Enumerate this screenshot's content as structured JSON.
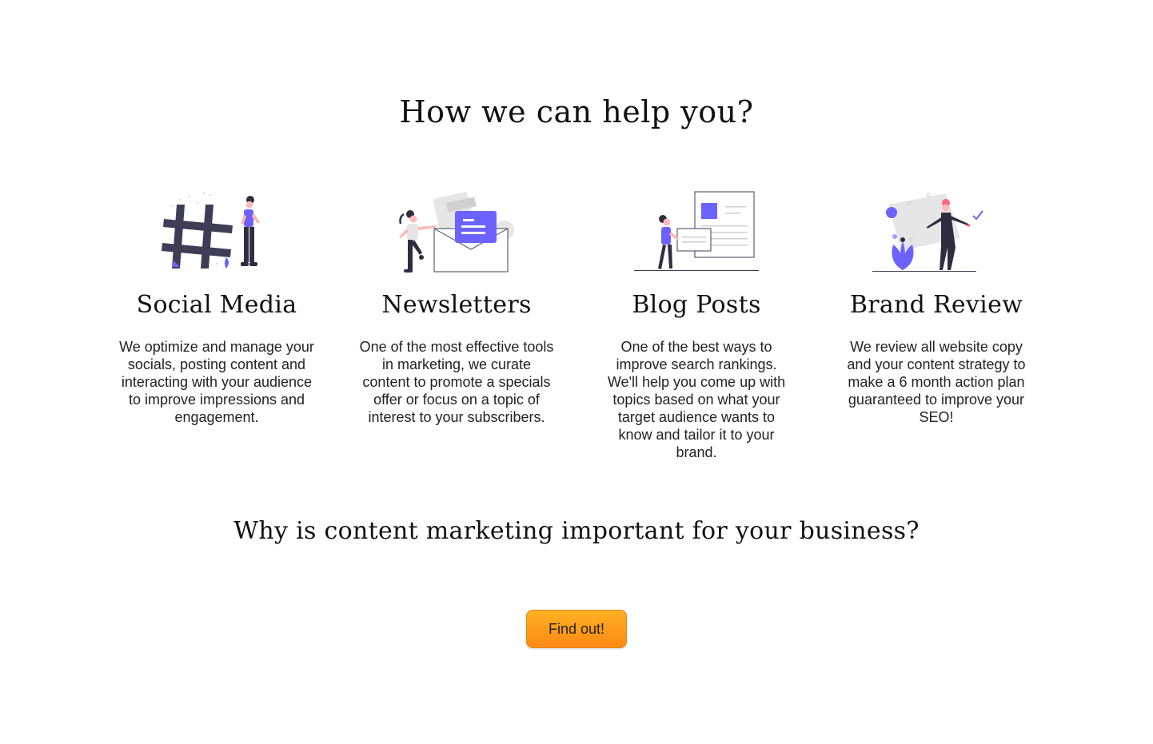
{
  "heading": "How we can help you?",
  "services": [
    {
      "title": "Social Media",
      "description": "We optimize and manage your socials, posting content and interacting with your audience to improve impressions and engagement.",
      "icon": "hashtag-illustration"
    },
    {
      "title": "Newsletters",
      "description": "One of the most effective tools in marketing, we curate content to promote a specials offer or focus on a topic of interest to your subscribers.",
      "icon": "envelope-illustration"
    },
    {
      "title": "Blog Posts",
      "description": "One of the best ways to improve search rankings. We'll help you come up with topics based on what your target audience wants to know and tailor it to your brand.",
      "icon": "documents-illustration"
    },
    {
      "title": "Brand Review",
      "description": "We review all website copy and your content strategy to make a 6 month action plan guaranteed to improve your SEO!",
      "icon": "checklist-illustration"
    }
  ],
  "subheading": "Why is content marketing important for your business?",
  "cta": {
    "label": "Find out!"
  },
  "colors": {
    "accent": "#6c63ff",
    "dark": "#3f3d56",
    "pink": "#ff6584",
    "button_top": "#ffb224",
    "button_bottom": "#ff8a14"
  }
}
